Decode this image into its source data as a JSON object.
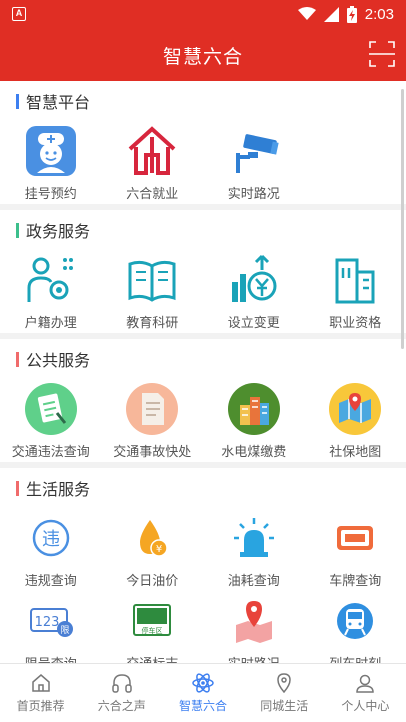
{
  "status_bar": {
    "app_badge": "A",
    "time": "2:03"
  },
  "header": {
    "title": "智慧六合"
  },
  "sections": [
    {
      "title": "智慧平台",
      "accent": "#3d7ff0",
      "items": [
        {
          "label": "挂号预约"
        },
        {
          "label": "六合就业"
        },
        {
          "label": "实时路况"
        }
      ]
    },
    {
      "title": "政务服务",
      "accent": "#3cbf8c",
      "items": [
        {
          "label": "户籍办理"
        },
        {
          "label": "教育科研"
        },
        {
          "label": "设立变更"
        },
        {
          "label": "职业资格"
        }
      ]
    },
    {
      "title": "公共服务",
      "accent": "#f06b6b",
      "items": [
        {
          "label": "交通违法查询"
        },
        {
          "label": "交通事故快处"
        },
        {
          "label": "水电煤缴费"
        },
        {
          "label": "社保地图"
        }
      ]
    },
    {
      "title": "生活服务",
      "accent": "#f06b6b",
      "items": [
        {
          "label": "违规查询"
        },
        {
          "label": "今日油价"
        },
        {
          "label": "油耗查询"
        },
        {
          "label": "车牌查询"
        },
        {
          "label": "限号查询"
        },
        {
          "label": "交通标志"
        },
        {
          "label": "实时路况"
        },
        {
          "label": "列车时刻"
        }
      ],
      "icon_text": {
        "violation": "违",
        "oil_price": "¥",
        "plate_number": "123",
        "plate_badge": "限",
        "sign": "停车区"
      }
    }
  ],
  "tabbar": {
    "tabs": [
      {
        "label": "首页推荐"
      },
      {
        "label": "六合之声"
      },
      {
        "label": "智慧六合"
      },
      {
        "label": "同城生活"
      },
      {
        "label": "个人中心"
      }
    ],
    "active_index": 2
  },
  "colors": {
    "primary_red": "#e02e24",
    "active_blue": "#3d7ff0",
    "teal": "#1aa3b8"
  }
}
